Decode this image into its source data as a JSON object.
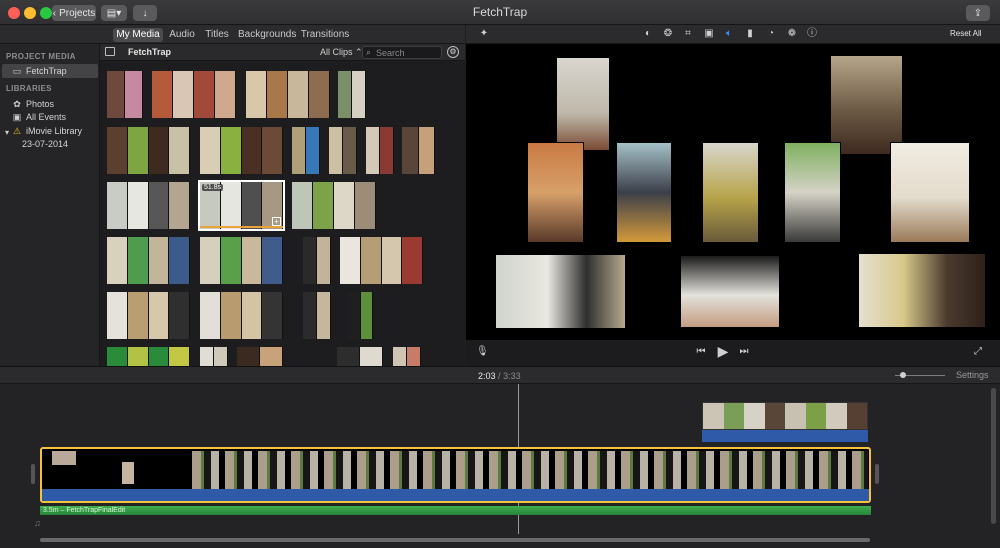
{
  "window": {
    "title": "FetchTrap",
    "projects_button": "Projects"
  },
  "tabs": [
    {
      "label": "My Media"
    },
    {
      "label": "Audio"
    },
    {
      "label": "Titles"
    },
    {
      "label": "Backgrounds"
    },
    {
      "label": "Transitions"
    }
  ],
  "sidebar": {
    "project_media_heading": "PROJECT MEDIA",
    "project_item": "FetchTrap",
    "libraries_heading": "LIBRARIES",
    "items": [
      {
        "label": "Photos",
        "icon": "photos-icon"
      },
      {
        "label": "All Events",
        "icon": "star-icon"
      },
      {
        "label": "iMovie Library",
        "icon": "warning-icon"
      },
      {
        "label": "23-07-2014",
        "icon": ""
      }
    ]
  },
  "browser": {
    "title": "FetchTrap",
    "filter": "All Clips",
    "search_placeholder": "Search",
    "selected_duration": "51.8s"
  },
  "viewer": {
    "reset_label": "Reset All"
  },
  "timeline": {
    "current_time": "2:03",
    "separator": "/",
    "total_time": "3:33",
    "settings_label": "Settings",
    "audio_clip_label": "3.5m – FetchTrapFinalEdit"
  },
  "colors": {
    "accent": "#2f63d8",
    "selection": "#f5c33b",
    "audio": "#2e8b3a",
    "warning": "#f5c02b"
  }
}
